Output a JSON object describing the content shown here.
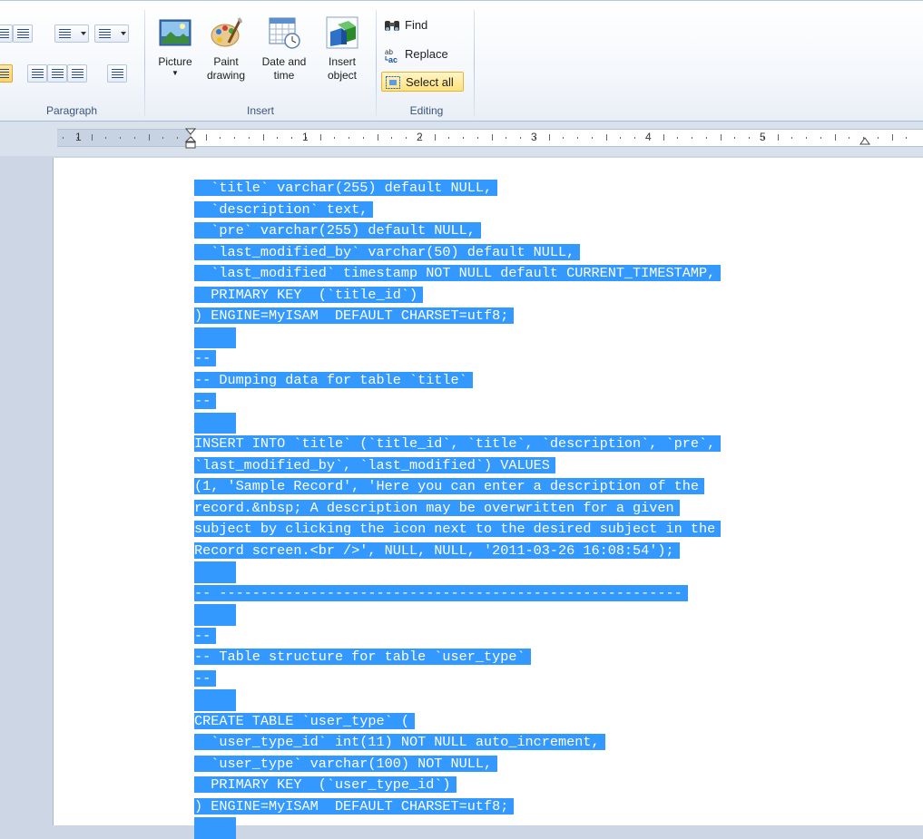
{
  "ribbon": {
    "paragraph": {
      "label": "Paragraph"
    },
    "insert": {
      "label": "Insert",
      "picture": {
        "line1": "Picture"
      },
      "paint": {
        "line1": "Paint",
        "line2": "drawing"
      },
      "datetime": {
        "line1": "Date and",
        "line2": "time"
      },
      "object": {
        "line1": "Insert",
        "line2": "object"
      }
    },
    "editing": {
      "label": "Editing",
      "find": "Find",
      "replace": "Replace",
      "select_all": "Select all"
    }
  },
  "ruler": {
    "numbers": [
      "1",
      "1",
      "2",
      "3",
      "4",
      "5"
    ]
  },
  "document": {
    "lines": [
      "  `title` varchar(255) default NULL,",
      "  `description` text,",
      "  `pre` varchar(255) default NULL,",
      "  `last_modified_by` varchar(50) default NULL,",
      "  `last_modified` timestamp NOT NULL default CURRENT_TIMESTAMP,",
      "  PRIMARY KEY  (`title_id`)",
      ") ENGINE=MyISAM  DEFAULT CHARSET=utf8;",
      "",
      "--",
      "-- Dumping data for table `title`",
      "--",
      "",
      "INSERT INTO `title` (`title_id`, `title`, `description`, `pre`,",
      "`last_modified_by`, `last_modified`) VALUES",
      "(1, 'Sample Record', 'Here you can enter a description of the",
      "record.&nbsp; A description may be overwritten for a given",
      "subject by clicking the icon next to the desired subject in the",
      "Record screen.<br />', NULL, NULL, '2011-03-26 16:08:54');",
      "",
      "-- --------------------------------------------------------",
      "",
      "--",
      "-- Table structure for table `user_type`",
      "--",
      "",
      "CREATE TABLE `user_type` (",
      "  `user_type_id` int(11) NOT NULL auto_increment,",
      "  `user_type` varchar(100) NOT NULL,",
      "  PRIMARY KEY  (`user_type_id`)",
      ") ENGINE=MyISAM  DEFAULT CHARSET=utf8;",
      ""
    ]
  },
  "colors": {
    "selection": "#3399ff",
    "ribbon_label": "#3b5578"
  }
}
